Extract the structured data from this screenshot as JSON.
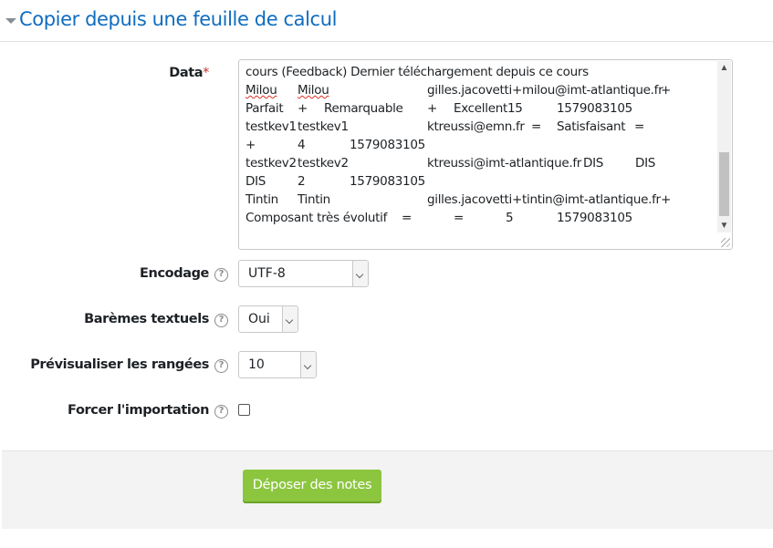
{
  "section": {
    "title": "Copier depuis une feuille de calcul"
  },
  "form": {
    "data_label": "Data",
    "required_mark": "*",
    "data_lines": [
      {
        "cols": [
          {
            "text": "cours (Feedback)  Dernier téléchargement depuis ce cours"
          }
        ]
      },
      {
        "cols": [
          {
            "text": "Milou",
            "wavy": true
          },
          {
            "text": "Milou",
            "wavy": true
          },
          {
            "text": "gilles.jacovetti+milou@imt-atlantique.fr"
          },
          {
            "text": "+"
          }
        ]
      },
      {
        "cols": [
          {
            "text": "Parfait"
          },
          {
            "text": "+"
          },
          {
            "text": "Remarquable"
          },
          {
            "text": "+"
          },
          {
            "text": "Excellent15"
          },
          {
            "text": "1579083105"
          }
        ]
      },
      {
        "cols": [
          {
            "text": "testkev1"
          },
          {
            "text": "testkev1"
          },
          {
            "text": "ktreussi@emn.fr"
          },
          {
            "text": "="
          },
          {
            "text": "Satisfaisant"
          },
          {
            "text": "="
          }
        ]
      },
      {
        "cols": [
          {
            "text": "+"
          },
          {
            "text": "4"
          },
          {
            "text": "1579083105"
          }
        ]
      },
      {
        "cols": [
          {
            "text": "testkev2"
          },
          {
            "text": "testkev2"
          },
          {
            "text": "ktreussi@imt-atlantique.fr"
          },
          {
            "text": "DIS"
          },
          {
            "text": "DIS"
          }
        ]
      },
      {
        "cols": [
          {
            "text": "DIS"
          },
          {
            "text": "2"
          },
          {
            "text": "1579083105"
          }
        ]
      },
      {
        "cols": [
          {
            "text": "Tintin"
          },
          {
            "text": "Tintin"
          },
          {
            "text": "gilles.jacovetti+tintin@imt-atlantique.fr"
          },
          {
            "text": "+"
          }
        ]
      },
      {
        "cols": [
          {
            "text": "Composant très évolutif"
          },
          {
            "text": "="
          },
          {
            "text": "="
          },
          {
            "text": "5"
          },
          {
            "text": "1579083105"
          }
        ]
      }
    ],
    "encoding_label": "Encodage",
    "encoding_value": "UTF-8",
    "text_scales_label": "Barèmes textuels",
    "text_scales_value": "Oui",
    "preview_rows_label": "Prévisualiser les rangées",
    "preview_rows_value": "10",
    "force_import_label": "Forcer l'importation",
    "force_import_checked": false,
    "help_glyph": "?",
    "submit_label": "Déposer des notes"
  },
  "icons": {
    "collapse": "caret-down-icon",
    "help": "question-circle-icon",
    "scroll_up": "chevron-up-icon",
    "scroll_down": "chevron-down-icon",
    "dropdown": "chevron-down-icon"
  },
  "colors": {
    "title": "#0f6cbf",
    "required": "#c4302b",
    "submit_bg": "#8cc63f",
    "footer_bg": "#f3f3f3"
  }
}
